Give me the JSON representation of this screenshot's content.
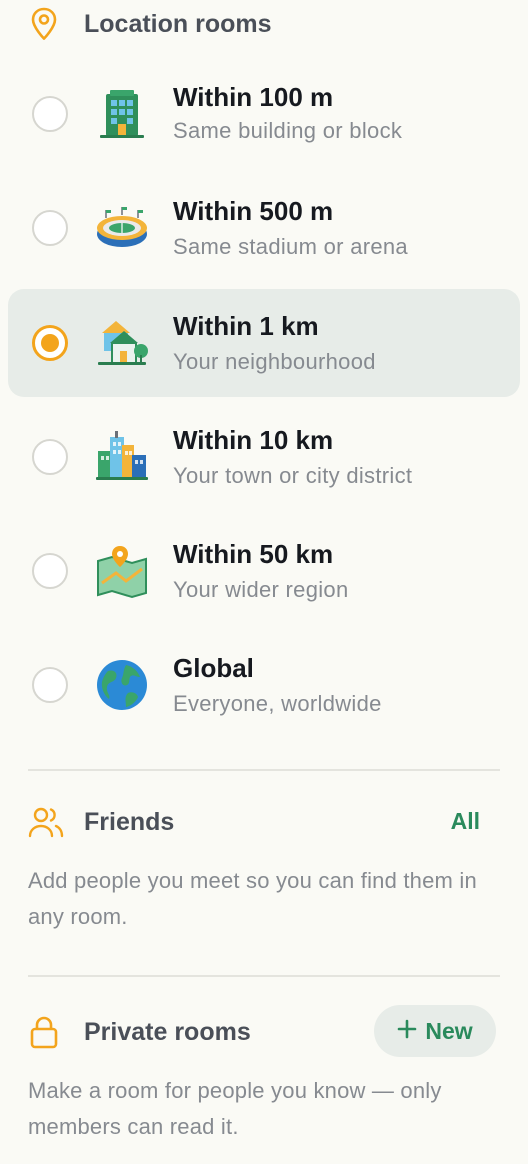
{
  "location": {
    "title": "Location rooms",
    "rooms": [
      {
        "title": "Within 100 m",
        "subtitle": "Same building or block",
        "icon": "office-building-icon",
        "selected": false
      },
      {
        "title": "Within 500 m",
        "subtitle": "Same stadium or arena",
        "icon": "stadium-icon",
        "selected": false
      },
      {
        "title": "Within 1 km",
        "subtitle": "Your neighbourhood",
        "icon": "houses-icon",
        "selected": true
      },
      {
        "title": "Within 10 km",
        "subtitle": "Your town or city district",
        "icon": "cityscape-icon",
        "selected": false
      },
      {
        "title": "Within 50 km",
        "subtitle": "Your wider region",
        "icon": "map-icon",
        "selected": false
      },
      {
        "title": "Global",
        "subtitle": "Everyone, worldwide",
        "icon": "globe-icon",
        "selected": false
      }
    ]
  },
  "friends": {
    "title": "Friends",
    "all_label": "All",
    "description": "Add people you meet so you can find them in any room."
  },
  "private_rooms": {
    "title": "Private rooms",
    "new_label": "New",
    "description": "Make a room for people you know — only members can read it."
  },
  "colors": {
    "accent": "#f3a41c",
    "green": "#2a8a5c",
    "selected_bg": "#e7ece8"
  }
}
